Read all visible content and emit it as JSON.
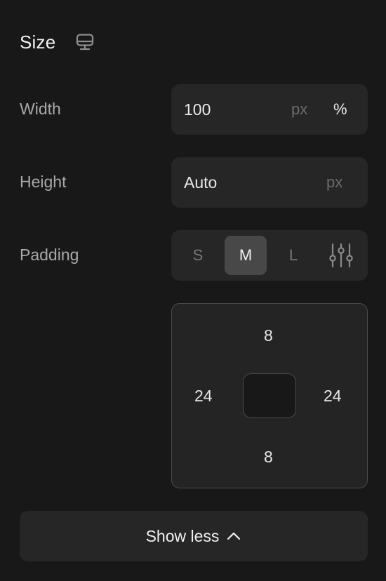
{
  "section": {
    "title": "Size",
    "device_icon": "desktop-icon"
  },
  "width": {
    "label": "Width",
    "value": "100",
    "units": [
      "px",
      "%"
    ],
    "active_unit": "%"
  },
  "height": {
    "label": "Height",
    "value": "Auto",
    "unit": "px"
  },
  "padding": {
    "label": "Padding",
    "options": [
      "S",
      "M",
      "L"
    ],
    "selected": "M",
    "custom_icon": "sliders-icon",
    "values": {
      "top": "8",
      "right": "24",
      "bottom": "8",
      "left": "24"
    }
  },
  "show_less": {
    "label": "Show less",
    "icon": "chevron-up-icon"
  },
  "colors": {
    "background": "#181818",
    "field": "#262626",
    "selected": "#484848",
    "text": "#f2f2f2",
    "muted": "#a8a8a8"
  }
}
